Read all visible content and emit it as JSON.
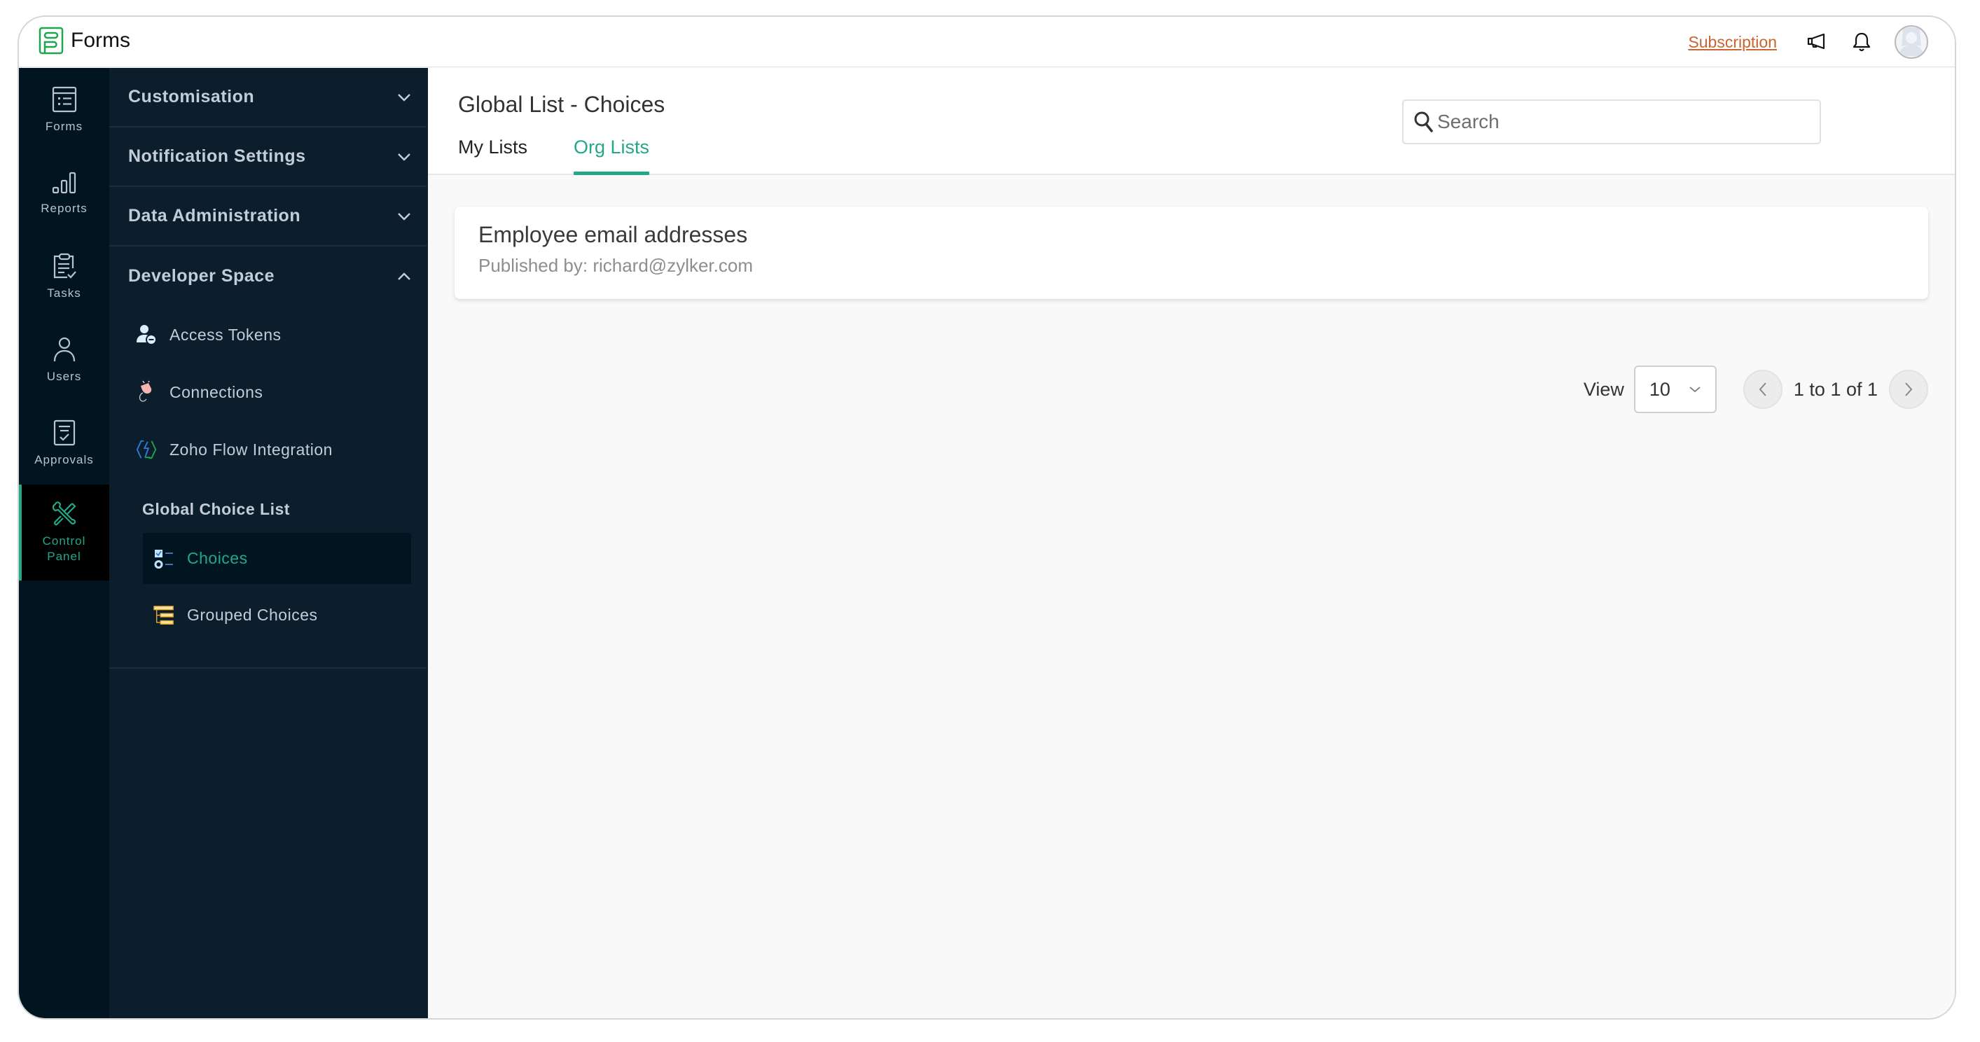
{
  "app": {
    "name": "Forms",
    "accent_color": "#22a889",
    "subscription_color": "#c9652f"
  },
  "topbar": {
    "subscription_label": "Subscription",
    "icons": [
      "megaphone-icon",
      "bell-icon",
      "avatar"
    ]
  },
  "rail": {
    "items": [
      {
        "label": "Forms",
        "icon": "forms-icon"
      },
      {
        "label": "Reports",
        "icon": "reports-icon"
      },
      {
        "label": "Tasks",
        "icon": "tasks-icon"
      },
      {
        "label": "Users",
        "icon": "users-icon"
      },
      {
        "label": "Approvals",
        "icon": "approvals-icon"
      },
      {
        "label_line1": "Control",
        "label_line2": "Panel",
        "icon": "tools-icon",
        "active": true
      }
    ]
  },
  "menu": {
    "sections": [
      {
        "label": "Customisation",
        "expanded": false
      },
      {
        "label": "Notification Settings",
        "expanded": false
      },
      {
        "label": "Data Administration",
        "expanded": false
      },
      {
        "label": "Developer Space",
        "expanded": true
      }
    ],
    "developer_items": [
      {
        "label": "Access Tokens",
        "icon": "access-token-icon"
      },
      {
        "label": "Connections",
        "icon": "plug-icon"
      },
      {
        "label": "Zoho Flow Integration",
        "icon": "zoho-flow-icon"
      }
    ],
    "group_heading": "Global Choice List",
    "group_items": [
      {
        "label": "Choices",
        "icon": "choices-icon",
        "active": true
      },
      {
        "label": "Grouped Choices",
        "icon": "grouped-choices-icon"
      }
    ]
  },
  "main": {
    "title": "Global List - Choices",
    "tabs": [
      {
        "label": "My Lists",
        "active": false
      },
      {
        "label": "Org Lists",
        "active": true
      }
    ],
    "search": {
      "placeholder": "Search",
      "value": ""
    },
    "lists": [
      {
        "title": "Employee email addresses",
        "published_by": "Published by: richard@zylker.com"
      }
    ],
    "pagination": {
      "view_label": "View",
      "page_size": "10",
      "range_text": "1 to 1 of 1"
    }
  }
}
